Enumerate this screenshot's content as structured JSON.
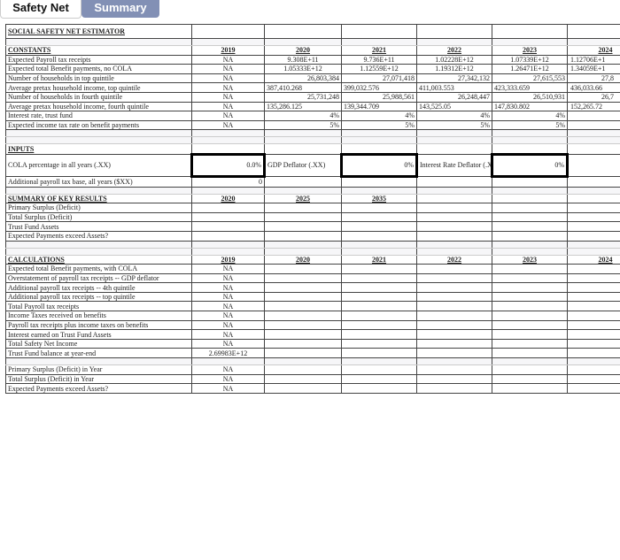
{
  "tabs": [
    "Safety Net",
    "Summary"
  ],
  "title": "SOCIAL SAFETY NET ESTIMATOR",
  "constants": {
    "header": "CONSTANTS",
    "years": [
      "2019",
      "2020",
      "2021",
      "2022",
      "2023",
      "2024"
    ],
    "rows": [
      {
        "label": "Expected Payroll tax receipts",
        "values": [
          "NA",
          "9.308E+11",
          "9.736E+11",
          "1.02228E+12",
          "1.07339E+12",
          "1.12706E+1"
        ]
      },
      {
        "label": "Expected total Benefit payments, no COLA",
        "values": [
          "NA",
          "1.05333E+12",
          "1.12559E+12",
          "1.19312E+12",
          "1.26471E+12",
          "1.34059E+1"
        ]
      },
      {
        "label": "Number of households in top quintile",
        "values": [
          "NA",
          "26,803,384",
          "27,071,418",
          "27,342,132",
          "27,615,553",
          "27,8"
        ]
      },
      {
        "label": "Average pretax household income, top quintile",
        "values": [
          "NA",
          "387,410.268",
          "399,032.576",
          "411,003.553",
          "423,333.659",
          "436,033.66"
        ]
      },
      {
        "label": "Number of households in fourth quintile",
        "values": [
          "NA",
          "25,731,248",
          "25,988,561",
          "26,248,447",
          "26,510,931",
          "26,7"
        ]
      },
      {
        "label": "Average pretax household income, fourth quintile",
        "values": [
          "NA",
          "135,286.125",
          "139,344.709",
          "143,525.05",
          "147,830.802",
          "152,265.72"
        ]
      },
      {
        "label": "Interest rate, trust fund",
        "values": [
          "NA",
          "4%",
          "4%",
          "4%",
          "4%",
          ""
        ]
      },
      {
        "label": "Expected income tax rate on benefit payments",
        "values": [
          "NA",
          "5%",
          "5%",
          "5%",
          "5%",
          ""
        ]
      }
    ]
  },
  "inputs": {
    "header": "INPUTS",
    "cola_label": "COLA percentage in all years (.XX)",
    "cola_value": "0.0%",
    "gdp_label": "GDP Deflator (.XX)",
    "gdp_value": "0%",
    "interest_label": "Interest Rate Deflator (.XX)",
    "interest_value": "0%",
    "payroll_label": "Additional payroll tax base, all years ($XX)",
    "payroll_value": "0"
  },
  "summary": {
    "header": "SUMMARY OF KEY RESULTS",
    "years": [
      "2020",
      "2025",
      "2035"
    ],
    "rows": [
      "Primary Surplus (Deficit)",
      "Total Surplus (Deficit)",
      "Trust Fund Assets",
      "Expected Payments exceed Assets?"
    ]
  },
  "calculations": {
    "header": "CALCULATIONS",
    "years": [
      "2019",
      "2020",
      "2021",
      "2022",
      "2023",
      "2024"
    ],
    "rows": [
      {
        "label": "Expected total Benefit payments, with COLA",
        "v2019": "NA"
      },
      {
        "label": "Overstatement of payroll tax receipts -- GDP deflator",
        "v2019": "NA"
      },
      {
        "label": "Additional payroll tax receipts -- 4th quintile",
        "v2019": "NA"
      },
      {
        "label": "Additional payroll tax receipts -- top quintile",
        "v2019": "NA"
      },
      {
        "label": "Total Payroll tax receipts",
        "v2019": "NA"
      },
      {
        "label": "Income Taxes received on benefits",
        "v2019": "NA"
      },
      {
        "label": "Payroll tax receipts plus income taxes on benefits",
        "v2019": "NA"
      },
      {
        "label": "Interest earned on Trust Fund Assets",
        "v2019": "NA"
      },
      {
        "label": "Total Safety Net Income",
        "v2019": "NA"
      },
      {
        "label": "Trust Fund balance at year-end",
        "v2019": "2.69983E+12"
      }
    ],
    "extra_rows": [
      {
        "label": "Primary Surplus (Deficit) in Year",
        "v2019": "NA"
      },
      {
        "label": "Total Surplus (Deficit) in Year",
        "v2019": "NA"
      },
      {
        "label": "Expected Payments exceed Assets?",
        "v2019": "NA"
      }
    ]
  }
}
